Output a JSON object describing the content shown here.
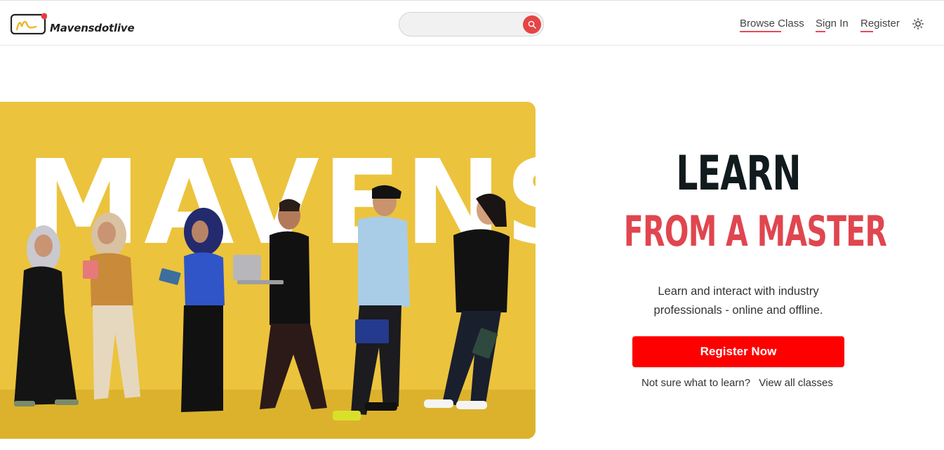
{
  "header": {
    "brand_name": "Mavensdotlive",
    "search": {
      "placeholder": "",
      "value": ""
    },
    "nav": [
      {
        "label": "Browse Class"
      },
      {
        "label": "Sign In"
      },
      {
        "label": "Register"
      }
    ],
    "theme_icon": "sun-icon",
    "search_icon": "search-icon"
  },
  "hero": {
    "image_word": "MAVENS",
    "colors": {
      "background": "#ecc33d",
      "floor": "#dcb22d"
    }
  },
  "main": {
    "headline_line1": "LEARN",
    "headline_line2": "FROM A MASTER",
    "subtitle": "Learn and interact with industry professionals - online and offline.",
    "cta_label": "Register Now",
    "helper_text": "Not sure what to learn?",
    "helper_link": "View all classes"
  },
  "colors": {
    "accent": "#e0464f",
    "cta": "#ff0000",
    "heading": "#111a1c"
  }
}
